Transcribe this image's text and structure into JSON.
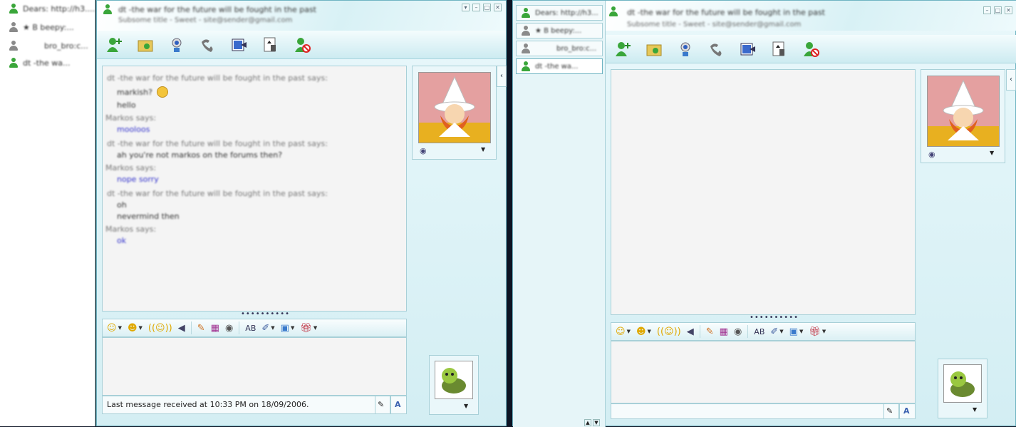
{
  "left_contacts": [
    {
      "label": "Dears: http://h3....",
      "status": "online"
    },
    {
      "label": "★ B beepy:...",
      "status": "offline"
    },
    {
      "label": "bro_bro:c...",
      "status": "offline"
    },
    {
      "label": "dt -the wa...",
      "status": "online"
    }
  ],
  "left_window": {
    "title": "dt -the war for the future will be fought in the past",
    "subtitle": "Subsome title - Sweet - site@sender@gmail.com",
    "conversation": [
      {
        "kind": "head",
        "text": "dt -the war for the future will be fought in the past says:"
      },
      {
        "kind": "body",
        "text": "markish?"
      },
      {
        "kind": "body",
        "text": "hello"
      },
      {
        "kind": "head",
        "text": "Markos says:"
      },
      {
        "kind": "blue",
        "text": "mooloos"
      },
      {
        "kind": "head",
        "text": "dt -the war for the future will be fought in the past says:"
      },
      {
        "kind": "body",
        "text": "ah you're not markos on the forums then?"
      },
      {
        "kind": "head",
        "text": "Markos says:"
      },
      {
        "kind": "blue",
        "text": "nope sorry"
      },
      {
        "kind": "head",
        "text": "dt -the war for the future will be fought in the past says:"
      },
      {
        "kind": "body",
        "text": "oh"
      },
      {
        "kind": "body",
        "text": "nevermind then"
      },
      {
        "kind": "head",
        "text": "Markos says:"
      },
      {
        "kind": "blue",
        "text": "ok"
      }
    ],
    "status_text": "Last message received at 10:33 PM on 18/09/2006."
  },
  "right_window": {
    "title": "dt -the war for the future will be fought in the past",
    "subtitle": "Subsome title - Sweet - site@sender@gmail.com",
    "tabs": [
      {
        "label": "Dears: http://h3...",
        "status": "online"
      },
      {
        "label": "★ B beepy:...",
        "status": "offline"
      },
      {
        "label": "bro_bro:c...",
        "status": "offline"
      },
      {
        "label": "dt -the wa...",
        "status": "online"
      }
    ]
  },
  "colors": {
    "online": "#3aa63a",
    "offline": "#8a8a8a",
    "accent": "#6fb4c2",
    "blue_text": "#3333cc"
  },
  "icons": {
    "toolbar": [
      "invite-icon",
      "send-files-icon",
      "video-call-icon",
      "phone-call-icon",
      "activities-icon",
      "games-icon",
      "block-icon"
    ],
    "format": [
      "emoticon-icon",
      "wink-icon",
      "nudge-icon",
      "voice-clip-icon",
      "ink-icon",
      "background-icon",
      "sound-icon",
      "spell-icon",
      "handwriting-icon",
      "share-icon",
      "gift-icon"
    ]
  }
}
